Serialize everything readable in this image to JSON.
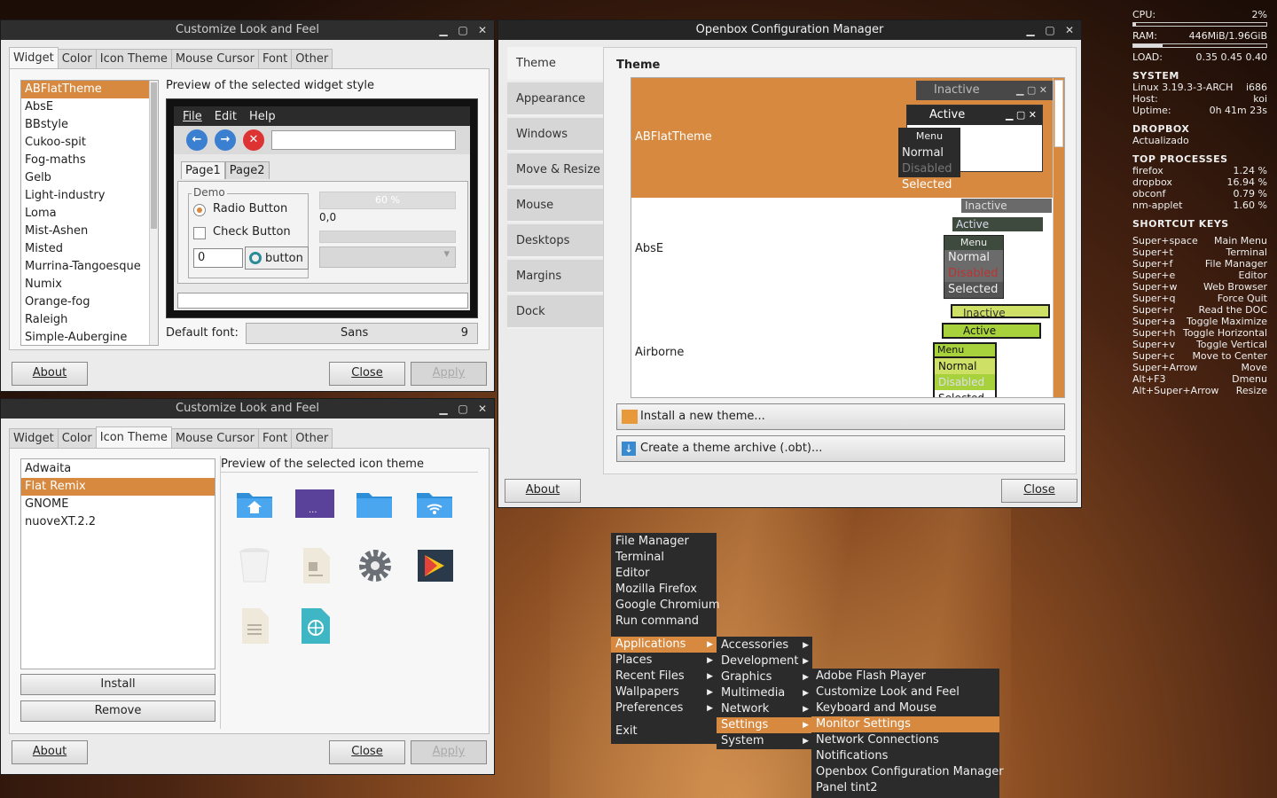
{
  "desktop": {
    "accent": "#d6893f"
  },
  "clf_top": {
    "title": "Customize Look and Feel",
    "tabs": [
      "Widget",
      "Color",
      "Icon Theme",
      "Mouse Cursor",
      "Font",
      "Other"
    ],
    "themes": [
      "ABFlatTheme",
      "AbsE",
      "BBstyle",
      "Cukoo-spit",
      "Fog-maths",
      "Gelb",
      "Light-industry",
      "Loma",
      "Mist-Ashen",
      "Misted",
      "Murrina-Tangoesque",
      "Numix",
      "Orange-fog",
      "Raleigh",
      "Simple-Aubergine"
    ],
    "preview_label": "Preview of the selected widget style",
    "preview": {
      "menu": [
        "File",
        "Edit",
        "Help"
      ],
      "page1": "Page1",
      "page2": "Page2",
      "demo": "Demo",
      "radio": "Radio Button",
      "check": "Check Button",
      "spin": "0",
      "button": "button",
      "progress": "60 %",
      "coord": "0,0"
    },
    "default_font_label": "Default font:",
    "font_name": "Sans",
    "font_size": "9",
    "about": "About",
    "close": "Close",
    "apply": "Apply"
  },
  "clf_bottom": {
    "title": "Customize Look and Feel",
    "tabs": [
      "Widget",
      "Color",
      "Icon Theme",
      "Mouse Cursor",
      "Font",
      "Other"
    ],
    "icon_themes": [
      "Adwaita",
      "Flat Remix",
      "GNOME",
      "nuoveXT.2.2"
    ],
    "preview_label": "Preview of the selected icon theme",
    "icons": [
      "home-folder-icon",
      "desktop-icon",
      "folder-icon",
      "network-folder-icon",
      "trash-icon",
      "document-icon",
      "settings-gear-icon",
      "play-store-icon",
      "text-file-icon",
      "web-file-icon"
    ],
    "install": "Install",
    "remove": "Remove",
    "about": "About",
    "close": "Close",
    "apply": "Apply"
  },
  "obconf": {
    "title": "Openbox Configuration Manager",
    "sections": [
      "Theme",
      "Appearance",
      "Windows",
      "Move & Resize",
      "Mouse",
      "Desktops",
      "Margins",
      "Dock"
    ],
    "theme_heading": "Theme",
    "themes": [
      {
        "name": "ABFlatTheme",
        "inactive": "Inactive",
        "active": "Active",
        "menu": "Menu",
        "normal": "Normal",
        "disabled": "Disabled",
        "selected": "Selected"
      },
      {
        "name": "AbsE",
        "inactive": "Inactive",
        "active": "Active",
        "menu": "Menu",
        "normal": "Normal",
        "disabled": "Disabled",
        "selected": "Selected"
      },
      {
        "name": "Airborne",
        "inactive": "Inactive",
        "active": "Active",
        "menu": "Menu",
        "normal": "Normal",
        "disabled": "Disabled",
        "selected": "Selected"
      }
    ],
    "install_theme": "Install a new theme...",
    "create_archive": "Create a theme archive (.obt)...",
    "about": "About",
    "close": "Close"
  },
  "root_menu": {
    "items": [
      "File Manager",
      "Terminal",
      "Editor",
      "Mozilla Firefox",
      "Google Chromium",
      "Run command"
    ],
    "submenus": [
      "Applications",
      "Places",
      "Recent Files",
      "Wallpapers",
      "Preferences"
    ],
    "exit": "Exit"
  },
  "apps_menu": [
    "Accessories",
    "Development",
    "Graphics",
    "Multimedia",
    "Network",
    "Settings",
    "System"
  ],
  "settings_menu": [
    "Adobe Flash Player",
    "Customize Look and Feel",
    "Keyboard and Mouse",
    "Monitor Settings",
    "Network Connections",
    "Notifications",
    "Openbox Configuration Manager",
    "Panel tint2"
  ],
  "conky": {
    "cpu_label": "CPU:",
    "cpu": "2%",
    "cpu_fraction": 0.02,
    "ram_label": "RAM:",
    "ram": "446MiB/1.96GiB",
    "ram_fraction": 0.22,
    "load_label": "LOAD:",
    "load": "0.35 0.45 0.40",
    "system_h": "SYSTEM",
    "kernel": "Linux 3.19.3-3-ARCH",
    "arch": "i686",
    "host_label": "Host:",
    "host": "koi",
    "uptime_label": "Uptime:",
    "uptime": "0h 41m 23s",
    "dropbox_h": "DROPBOX",
    "dropbox": "Actualizado",
    "proc_h": "TOP PROCESSES",
    "procs": [
      {
        "name": "firefox",
        "cpu": "1.24 %"
      },
      {
        "name": "dropbox",
        "cpu": "16.94 %"
      },
      {
        "name": "obconf",
        "cpu": "0.79 %"
      },
      {
        "name": "nm-applet",
        "cpu": "1.60 %"
      }
    ],
    "keys_h": "SHORTCUT KEYS",
    "keys": [
      {
        "k": "Super+space",
        "a": "Main Menu"
      },
      {
        "k": "Super+t",
        "a": "Terminal"
      },
      {
        "k": "Super+f",
        "a": "File Manager"
      },
      {
        "k": "Super+e",
        "a": "Editor"
      },
      {
        "k": "Super+w",
        "a": "Web Browser"
      },
      {
        "k": "Super+q",
        "a": "Force Quit"
      },
      {
        "k": "Super+r",
        "a": "Read the DOC"
      },
      {
        "k": "Super+a",
        "a": "Toggle Maximize"
      },
      {
        "k": "Super+h",
        "a": "Toggle Horizontal"
      },
      {
        "k": "Super+v",
        "a": "Toggle Vertical"
      },
      {
        "k": "Super+c",
        "a": "Move to Center"
      },
      {
        "k": "Super+Arrow",
        "a": "Move"
      },
      {
        "k": "Alt+F3",
        "a": "Dmenu"
      },
      {
        "k": "Alt+Super+Arrow",
        "a": "Resize"
      }
    ]
  }
}
